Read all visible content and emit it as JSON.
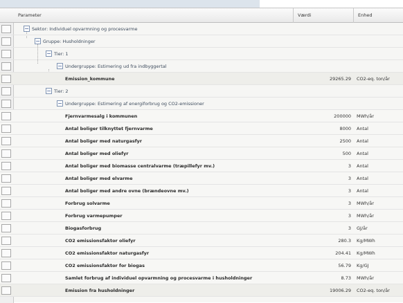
{
  "header": {
    "parameter": "Parameter",
    "value": "Værdi",
    "unit": "Enhed"
  },
  "tree": {
    "sector": "Sektor: Individuel opvarmning og procesvarme",
    "group": "Gruppe: Husholdninger",
    "tier1": "Tier: 1",
    "subgroup1": "Undergruppe: Estimering ud fra indbyggertal",
    "tier2": "Tier: 2",
    "subgroup2": "Undergruppe: Estimering af energiforbrug og CO2-emissioner",
    "toggle_symbol": "−"
  },
  "emission_row": {
    "label": "Emission_kommune",
    "value": "29265.29",
    "unit": "CO2-eq. ton/år"
  },
  "rows": [
    {
      "label": "Fjernvarmesalg i kommunen",
      "value": "200000",
      "unit": "MWh/år"
    },
    {
      "label": "Antal boliger tilknyttet fjernvarme",
      "value": "8000",
      "unit": "Antal"
    },
    {
      "label": "Antal boliger med naturgasfyr",
      "value": "2500",
      "unit": "Antal"
    },
    {
      "label": "Antal boliger med oliefyr",
      "value": "500",
      "unit": "Antal"
    },
    {
      "label": "Antal boliger med biomasse centralvarme (træpillefyr mv.)",
      "value": "3",
      "unit": "Antal"
    },
    {
      "label": "Antal boliger med elvarme",
      "value": "3",
      "unit": "Antal"
    },
    {
      "label": "Antal boliger med andre ovne (brændeovne mv.)",
      "value": "3",
      "unit": "Antal"
    },
    {
      "label": "Forbrug solvarme",
      "value": "3",
      "unit": "MWh/år"
    },
    {
      "label": "Forbrug varmepumper",
      "value": "3",
      "unit": "MWh/år"
    },
    {
      "label": "Biogasforbrug",
      "value": "3",
      "unit": "GJ/år"
    },
    {
      "label": "CO2 emissionsfaktor oliefyr",
      "value": "280.3",
      "unit": "Kg/MWh"
    },
    {
      "label": "CO2 emissionsfaktor naturgasfyr",
      "value": "204.41",
      "unit": "Kg/MWh"
    },
    {
      "label": "CO2 emissionsfaktor for biogas",
      "value": "56.79",
      "unit": "Kg/GJ"
    },
    {
      "label": "Samlet forbrug af individuel opvarmning og procesvarme i husholdninger",
      "value": "8.73",
      "unit": "MWh/år"
    },
    {
      "label": "Emission fra husholdninger",
      "value": "19006.29",
      "unit": "CO2-eq. ton/år"
    }
  ]
}
